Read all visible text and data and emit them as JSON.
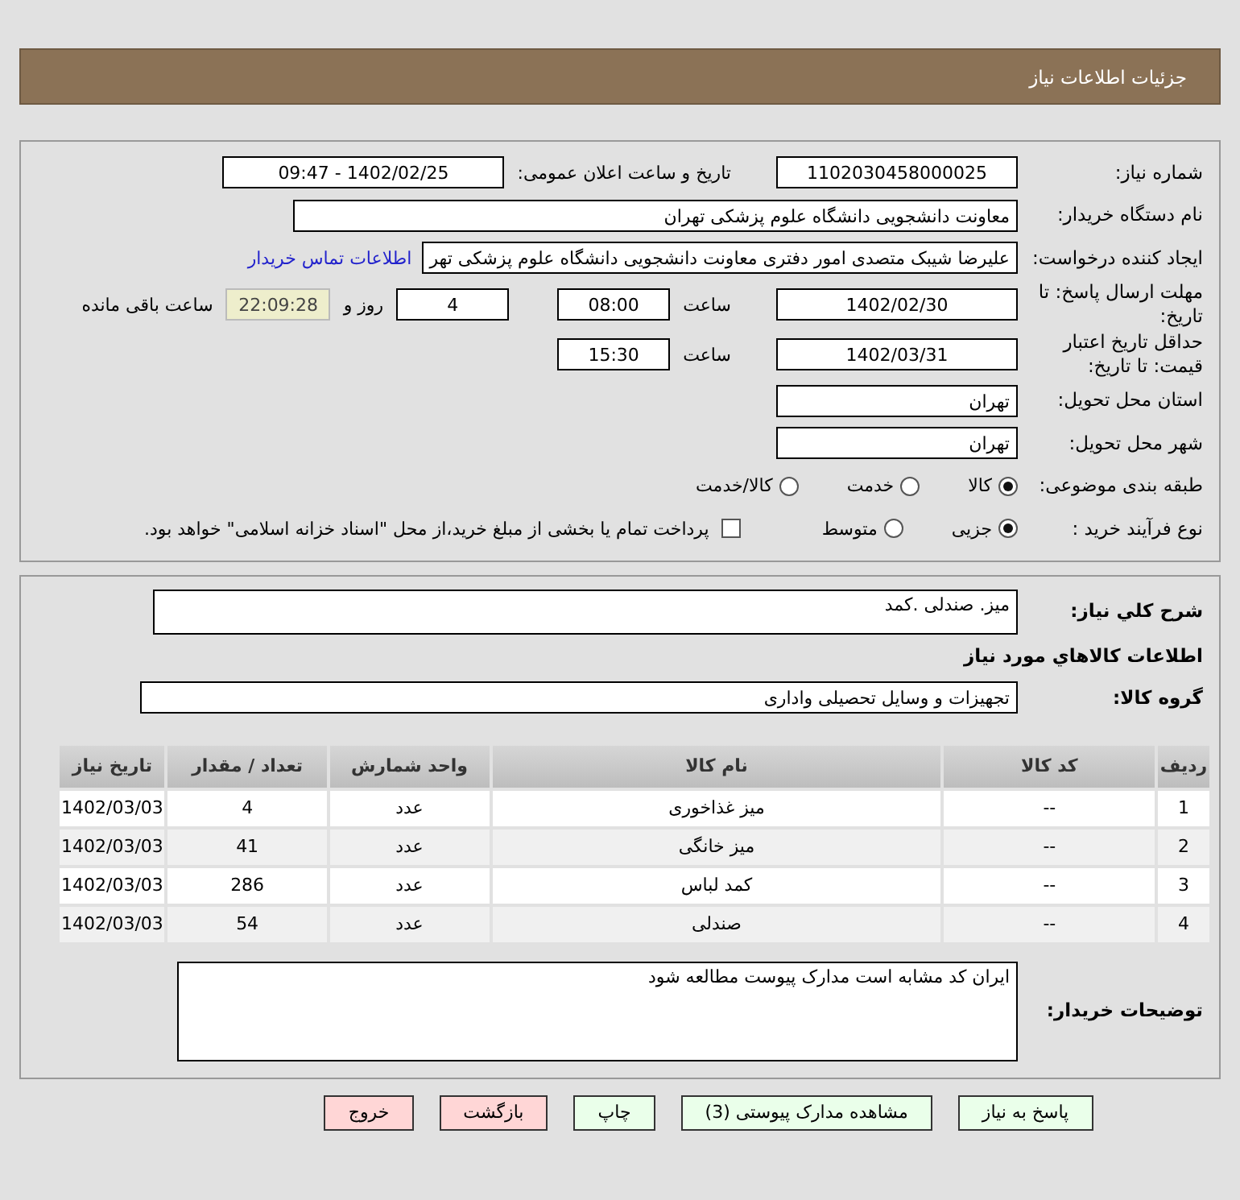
{
  "header": {
    "title": "جزئیات اطلاعات نیاز"
  },
  "form": {
    "need_number": {
      "label": "شماره نیاز:",
      "value": "1102030458000025"
    },
    "announce": {
      "label": "تاریخ و ساعت اعلان عمومی:",
      "value": "1402/02/25 - 09:47"
    },
    "buyer_org": {
      "label": "نام دستگاه خریدار:",
      "value": "معاونت دانشجویی دانشگاه علوم پزشکی تهران"
    },
    "requester": {
      "label": "ایجاد کننده درخواست:",
      "value": "علیرضا شیبک متصدی امور دفتری معاونت دانشجویی دانشگاه علوم پزشکی تهر",
      "link": "اطلاعات تماس خریدار"
    },
    "deadline": {
      "label": "مهلت ارسال پاسخ: تا تاریخ:",
      "date": "1402/02/30",
      "time_label": "ساعت",
      "time": "08:00",
      "days": "4",
      "days_label": "روز و",
      "remaining": "22:09:28",
      "remaining_label": "ساعت باقی مانده"
    },
    "validity": {
      "label": "حداقل تاریخ اعتبار قیمت: تا تاریخ:",
      "date": "1402/03/31",
      "time_label": "ساعت",
      "time": "15:30"
    },
    "province": {
      "label": "استان محل تحویل:",
      "value": "تهران"
    },
    "city": {
      "label": "شهر محل تحویل:",
      "value": "تهران"
    },
    "category": {
      "label": "طبقه بندی موضوعی:",
      "options": [
        {
          "label": "کالا",
          "selected": true
        },
        {
          "label": "خدمت",
          "selected": false
        },
        {
          "label": "کالا/خدمت",
          "selected": false
        }
      ]
    },
    "process": {
      "label": "نوع فرآیند خرید :",
      "options": [
        {
          "label": "جزیی",
          "selected": true
        },
        {
          "label": "متوسط",
          "selected": false
        }
      ],
      "checkbox": {
        "label": "پرداخت تمام یا بخشی از مبلغ خرید،از محل \"اسناد خزانه اسلامی\" خواهد بود.",
        "checked": false
      }
    }
  },
  "details": {
    "description": {
      "label": "شرح کلي نياز:",
      "value": "میز. صندلی .کمد"
    },
    "goods_heading": "اطلاعات کالاهاي مورد نياز",
    "group": {
      "label": "گروه کالا:",
      "value": "تجهیزات و وسایل تحصیلی واداری"
    },
    "table": {
      "columns": [
        "ردیف",
        "کد کالا",
        "نام کالا",
        "واحد شمارش",
        "تعداد / مقدار",
        "تاریخ نیاز"
      ],
      "rows": [
        [
          "1",
          "--",
          "میز غذاخوری",
          "عدد",
          "4",
          "1402/03/03"
        ],
        [
          "2",
          "--",
          "میز خانگی",
          "عدد",
          "41",
          "1402/03/03"
        ],
        [
          "3",
          "--",
          "کمد لباس",
          "عدد",
          "286",
          "1402/03/03"
        ],
        [
          "4",
          "--",
          "صندلی",
          "عدد",
          "54",
          "1402/03/03"
        ]
      ]
    },
    "notes": {
      "label": "توضیحات خریدار:",
      "value": "ایران کد مشابه است مدارک پیوست مطالعه شود"
    }
  },
  "buttons": [
    {
      "label": "پاسخ به نیاز",
      "kind": "action"
    },
    {
      "label": "مشاهده مدارک پیوستی (3)",
      "kind": "action"
    },
    {
      "label": "چاپ",
      "kind": "action"
    },
    {
      "label": "بازگشت",
      "kind": "exit"
    },
    {
      "label": "خروج",
      "kind": "exit"
    }
  ]
}
